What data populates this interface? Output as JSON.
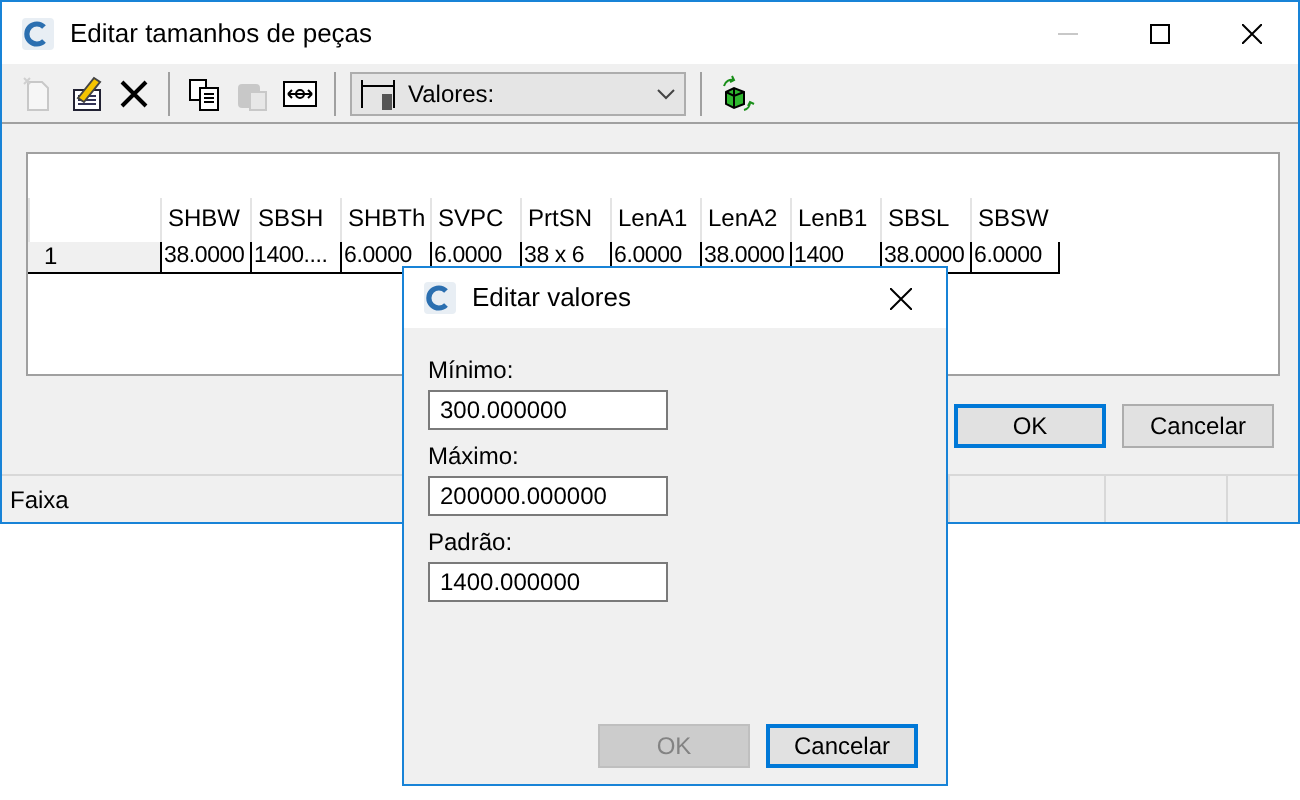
{
  "window": {
    "title": "Editar tamanhos de peças"
  },
  "toolbar": [
    {
      "kind": "new",
      "disabled": true
    },
    {
      "kind": "edit",
      "disabled": false
    },
    {
      "kind": "delete",
      "disabled": false
    },
    {
      "kind": "sep"
    },
    {
      "kind": "copy",
      "disabled": false
    },
    {
      "kind": "paste",
      "disabled": true
    },
    {
      "kind": "resize",
      "disabled": false
    },
    {
      "kind": "sep"
    },
    {
      "kind": "combo",
      "value": "Valores:"
    },
    {
      "kind": "sep"
    },
    {
      "kind": "cube",
      "disabled": false
    }
  ],
  "table": {
    "columns": [
      "SHBW",
      "SBSH",
      "SHBTh",
      "SVPC",
      "PrtSN",
      "LenA1",
      "LenA2",
      "LenB1",
      "SBSL",
      "SBSW"
    ],
    "rows": [
      {
        "header": "1",
        "cells": [
          "38.0000",
          "1400....",
          "6.0000",
          "6.0000",
          "38 x 6",
          "6.0000",
          "38.0000",
          "1400",
          "38.0000",
          "6.0000"
        ]
      }
    ]
  },
  "buttons": [
    {
      "label": "OK",
      "default": true
    },
    {
      "label": "Cancelar",
      "default": false
    }
  ],
  "status_bar": {
    "text": "Faixa"
  },
  "dialog": {
    "title": "Editar valores",
    "fields": [
      {
        "label": "Mínimo:",
        "value": "300.000000"
      },
      {
        "label": "Máximo:",
        "value": "200000.000000"
      },
      {
        "label": "Padrão:",
        "value": "1400.000000"
      }
    ],
    "buttons": [
      {
        "label": "OK",
        "disabled": true,
        "default": false
      },
      {
        "label": "Cancelar",
        "disabled": false,
        "default": true
      }
    ]
  }
}
